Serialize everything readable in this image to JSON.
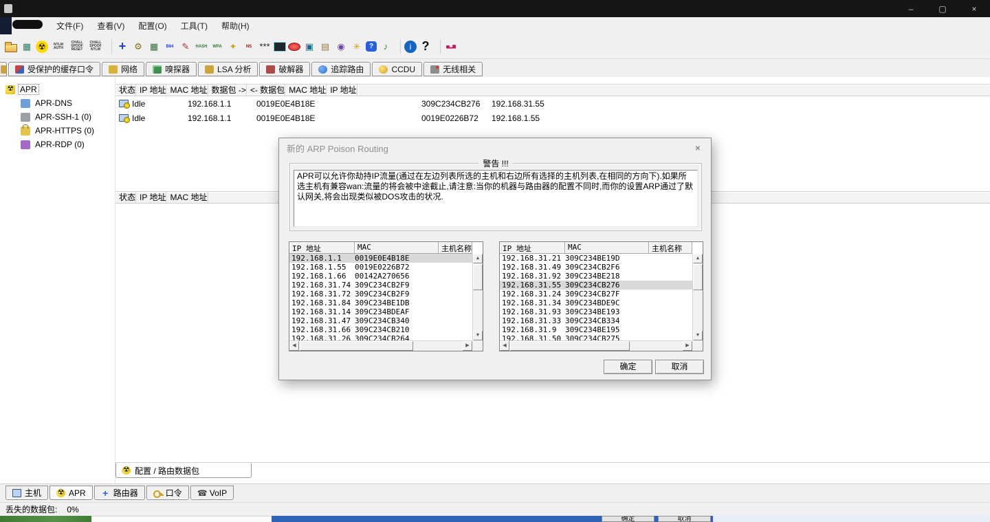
{
  "titlebar": {
    "minimize": "–",
    "maximize": "▢",
    "close": "×"
  },
  "menu": {
    "items": [
      "文件(F)",
      "查看(V)",
      "配置(O)",
      "工具(T)",
      "帮助(H)"
    ]
  },
  "toolbar": {
    "icons": [
      {
        "name": "open-folder-icon",
        "cls": "folder"
      },
      {
        "name": "network-card-icon",
        "label": "▦",
        "fg": "#2e7d64"
      },
      {
        "name": "radioactive-icon",
        "label": "☢",
        "cls": "round",
        "fg": "#1a1a00",
        "bg": "#ffd900"
      },
      {
        "name": "ntlm-auth-icon",
        "label": "NTLM\nAUTH",
        "cls": "tiny"
      },
      {
        "name": "chall-spoof-reset-icon",
        "label": "CHALL\nSPOOF\nRESET",
        "cls": "tiny"
      },
      {
        "name": "chall-spoof-ntlm-icon",
        "label": "CHALL\nSPOOF\nNTLM",
        "cls": "tiny"
      },
      {
        "name": "toolbar-separator",
        "cls": "sep",
        "interactable": false
      },
      {
        "name": "add-to-list-icon",
        "label": "+",
        "cls": "big",
        "fg": "#1f3fd4"
      },
      {
        "name": "injector-icon",
        "label": "⚙",
        "fg": "#8a6d1d"
      },
      {
        "name": "grid-icon",
        "label": "▦",
        "fg": "#3b6e3b"
      },
      {
        "name": "base64-icon",
        "label": "B64",
        "cls": "micro",
        "fg": "#1f3fd4"
      },
      {
        "name": "editor-icon",
        "label": "✎",
        "fg": "#b23030"
      },
      {
        "name": "hash-calculator-icon",
        "label": "HASH",
        "cls": "micro",
        "fg": "#2e7d32"
      },
      {
        "name": "wpa-calculator-icon",
        "label": "WPA",
        "cls": "micro",
        "fg": "#2e7d32"
      },
      {
        "name": "rsa-token-icon",
        "label": "✦",
        "fg": "#c9a227"
      },
      {
        "name": "ns-lookup-icon",
        "label": "NS",
        "cls": "micro",
        "fg": "#a31515"
      },
      {
        "name": "asterisks-icon",
        "label": "***",
        "fg": "#222222"
      },
      {
        "name": "remote-console-icon",
        "cls": "screen"
      },
      {
        "name": "remote-desktop-icon",
        "cls": "redoval"
      },
      {
        "name": "tftp-icon",
        "label": "▣",
        "fg": "#0b7285"
      },
      {
        "name": "certificates-icon",
        "label": "▤",
        "fg": "#9a7b4f"
      },
      {
        "name": "globes-icon",
        "label": "◉",
        "fg": "#7048a8"
      },
      {
        "name": "wireless-scan-icon",
        "label": "✳",
        "fg": "#d4a017"
      },
      {
        "name": "query-icon",
        "label": "?",
        "cls": "bubble",
        "fg": "#ffffff",
        "bg": "#2b5fd9"
      },
      {
        "name": "voip-speaker-icon",
        "label": "♪",
        "fg": "#2e7d32"
      },
      {
        "name": "toolbar-separator",
        "cls": "sep",
        "interactable": false
      },
      {
        "name": "about-icon",
        "label": "i",
        "cls": "round",
        "fg": "#ffffff",
        "bg": "#1565c0"
      },
      {
        "name": "help-icon",
        "label": "?",
        "cls": "big",
        "fg": "#111111"
      },
      {
        "name": "toolbar-separator",
        "cls": "sep",
        "interactable": false
      },
      {
        "name": "stats-icon",
        "label": "▅▂▆",
        "cls": "micro",
        "fg": "#c2185b"
      }
    ]
  },
  "tab_bar": {
    "tabs": [
      {
        "name": "tab-protected-cache-passwords",
        "icon": "cache-passwords-icon",
        "label": "受保护的缓存口令"
      },
      {
        "name": "tab-network",
        "icon": "network-tab-icon",
        "label": "网络"
      },
      {
        "name": "tab-sniffer",
        "icon": "sniffer-tab-icon",
        "label": "嗅探器"
      },
      {
        "name": "tab-lsa",
        "icon": "lsa-tab-icon",
        "label": "LSA 分析"
      },
      {
        "name": "tab-cracker",
        "icon": "cracker-tab-icon",
        "label": "破解器"
      },
      {
        "name": "tab-traceroute",
        "icon": "traceroute-tab-icon",
        "label": "追踪路由"
      },
      {
        "name": "tab-ccdu",
        "icon": "ccdu-tab-icon",
        "label": "CCDU"
      },
      {
        "name": "tab-wireless",
        "icon": "wireless-tab-icon",
        "label": "无线相关"
      }
    ]
  },
  "sidebar": {
    "items": [
      {
        "name": "sidebar-item-apr",
        "icon": "apr-radioactive-icon",
        "label": "APR",
        "selected": true
      },
      {
        "name": "sidebar-item-apr-dns",
        "icon": "apr-dns-icon",
        "label": "APR-DNS",
        "cls": "child"
      },
      {
        "name": "sidebar-item-apr-ssh",
        "icon": "apr-ssh-icon",
        "label": "APR-SSH-1 (0)",
        "cls": "child"
      },
      {
        "name": "sidebar-item-apr-https",
        "icon": "apr-https-icon",
        "label": "APR-HTTPS (0)",
        "cls": "child"
      },
      {
        "name": "sidebar-item-apr-rdp",
        "icon": "apr-rdp-icon",
        "label": "APR-RDP (0)",
        "cls": "child"
      }
    ]
  },
  "upper_table": {
    "columns": [
      "状态",
      "IP 地址",
      "MAC 地址",
      "数据包 ->",
      "<- 数据包",
      "MAC 地址",
      "IP 地址"
    ],
    "rows": [
      {
        "status": "Idle",
        "ip_left": "192.168.1.1",
        "mac_left": "0019E0E4B18E",
        "packets_to": "",
        "packets_from": "",
        "mac_right": "309C234CB276",
        "ip_right": "192.168.31.55"
      },
      {
        "status": "Idle",
        "ip_left": "192.168.1.1",
        "mac_left": "0019E0E4B18E",
        "packets_to": "",
        "packets_from": "",
        "mac_right": "0019E0226B72",
        "ip_right": "192.168.1.55"
      }
    ]
  },
  "lower_table": {
    "columns": [
      "状态",
      "IP 地址",
      "MAC 地址"
    ]
  },
  "view_tab": {
    "label": "配置 / 路由数据包"
  },
  "bottom_tab_bar": {
    "tabs": [
      {
        "name": "bottom-tab-hosts",
        "icon": "host-tab-icon",
        "label": "主机"
      },
      {
        "name": "bottom-tab-apr",
        "icon": "apr-radioactive-icon",
        "label": "APR",
        "selected": true
      },
      {
        "name": "bottom-tab-routing",
        "icon": "routing-tab-icon",
        "label": "路由器"
      },
      {
        "name": "bottom-tab-passwords",
        "icon": "passwords-tab-icon",
        "label": "口令"
      },
      {
        "name": "bottom-tab-voip",
        "icon": "voip-tab-icon",
        "label": "VoIP"
      }
    ]
  },
  "status_bar": {
    "label": "丢失的数据包:",
    "value": "0%"
  },
  "background": {
    "ok": "确定",
    "cancel": "取消"
  },
  "dialog": {
    "title": "新的 ARP Poison Routing",
    "close": "×",
    "warning": {
      "label": "警告 !!!",
      "text": "APR可以允许你劫持IP流量(通过在左边列表所选的主机和右边所有选择的主机列表,在相同的方向下).如果所选主机有兼容wan:流量的将会被中途截止,请注意:当你的机器与路由器的配置不同时,而你的设置ARP通过了默认网关,将会出现类似被DOS攻击的状况."
    },
    "list_columns": [
      "IP 地址",
      "MAC",
      "主机名称"
    ],
    "left_list": {
      "rows": [
        {
          "ip": "192.168.1.1",
          "mac": "0019E0E4B18E",
          "host": "",
          "selected": true
        },
        {
          "ip": "192.168.1.55",
          "mac": "0019E0226B72",
          "host": ""
        },
        {
          "ip": "192.168.1.66",
          "mac": "00142A270656",
          "host": ""
        },
        {
          "ip": "192.168.31.74",
          "mac": "309C234CB2F9",
          "host": ""
        },
        {
          "ip": "192.168.31.72",
          "mac": "309C234CB2F9",
          "host": ""
        },
        {
          "ip": "192.168.31.84",
          "mac": "309C234BE1DB",
          "host": ""
        },
        {
          "ip": "192.168.31.14",
          "mac": "309C234BDEAF",
          "host": ""
        },
        {
          "ip": "192.168.31.47",
          "mac": "309C234CB340",
          "host": ""
        },
        {
          "ip": "192.168.31.66",
          "mac": "309C234CB210",
          "host": ""
        },
        {
          "ip": "192.168.31.26",
          "mac": "309C234CB264",
          "host": ""
        }
      ]
    },
    "right_list": {
      "rows": [
        {
          "ip": "192.168.31.21",
          "mac": "309C234BE19D",
          "host": ""
        },
        {
          "ip": "192.168.31.49",
          "mac": "309C234CB2F6",
          "host": ""
        },
        {
          "ip": "192.168.31.92",
          "mac": "309C234BE218",
          "host": ""
        },
        {
          "ip": "192.168.31.55",
          "mac": "309C234CB276",
          "host": "",
          "selected": true
        },
        {
          "ip": "192.168.31.24",
          "mac": "309C234CB27F",
          "host": ""
        },
        {
          "ip": "192.168.31.34",
          "mac": "309C234BDE9C",
          "host": ""
        },
        {
          "ip": "192.168.31.93",
          "mac": "309C234BE193",
          "host": ""
        },
        {
          "ip": "192.168.31.33",
          "mac": "309C234CB334",
          "host": ""
        },
        {
          "ip": "192.168.31.9",
          "mac": "309C234BE195",
          "host": ""
        },
        {
          "ip": "192.168.31.50",
          "mac": "309C234CB275",
          "host": ""
        }
      ]
    },
    "ok_label": "确定",
    "cancel_label": "取消"
  }
}
